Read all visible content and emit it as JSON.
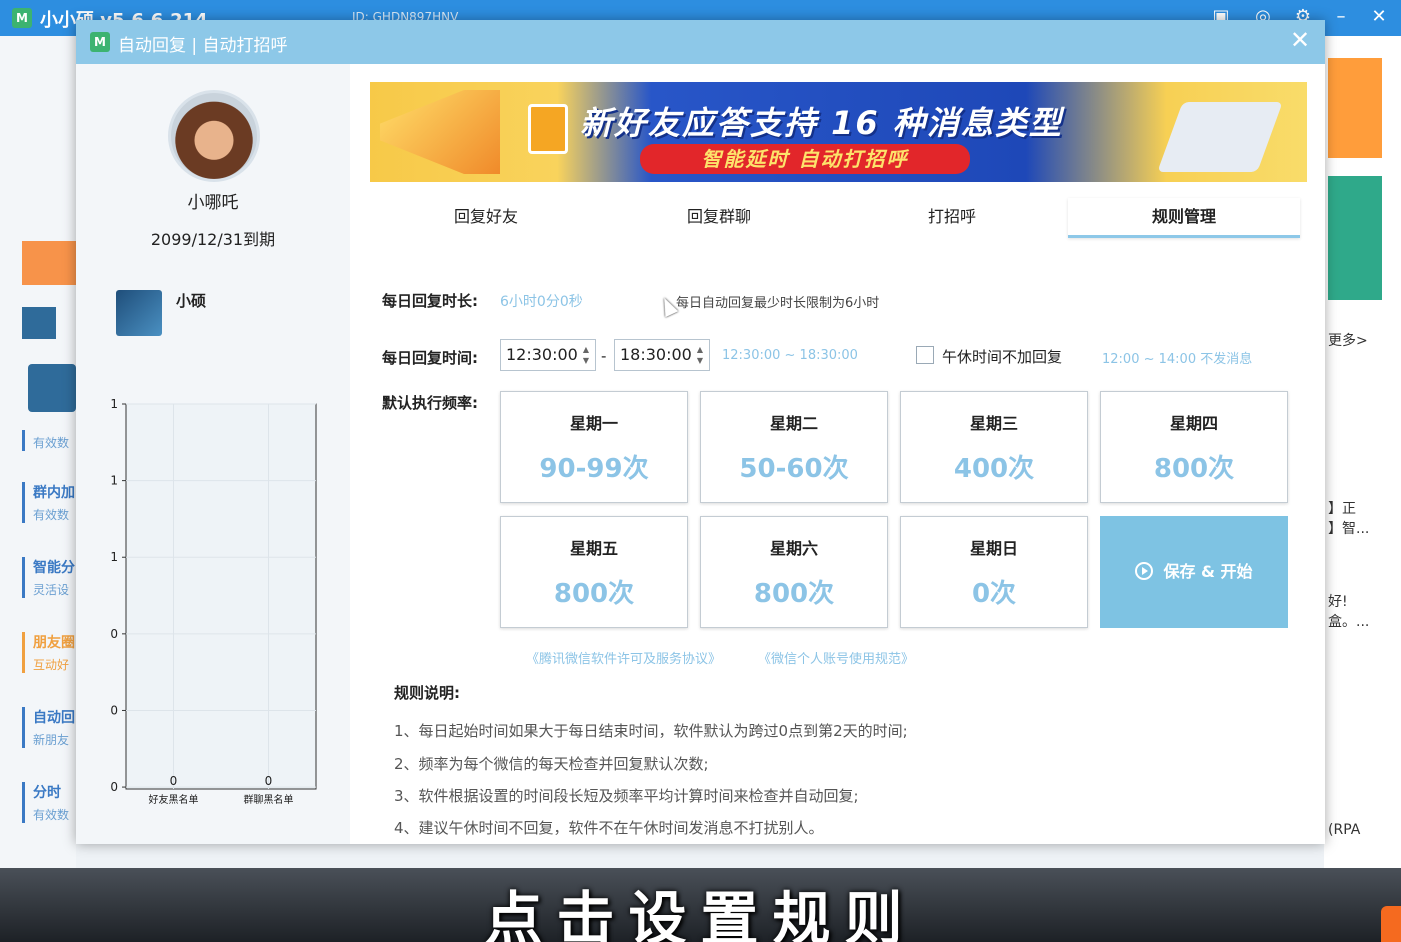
{
  "background_app": {
    "title": "小小硕 v5.6.6.214",
    "id_text": "ID: GHDN897HNV",
    "side_items": [
      {
        "title": "",
        "sub": "有效数"
      },
      {
        "title": "群内加",
        "sub": "有效数"
      },
      {
        "title": "智能分",
        "sub": "灵活设"
      },
      {
        "title": "朋友圈",
        "sub": "互动好"
      },
      {
        "title": "自动回",
        "sub": "新朋友"
      },
      {
        "title": "分时",
        "sub": "有效数"
      }
    ],
    "right_texts": [
      "更多>",
      "】正",
      "】智...",
      "好!",
      "盒。...",
      "(RPA"
    ]
  },
  "dialog": {
    "title": "自动回复 | 自动打招呼",
    "close_glyph": "✕",
    "user": {
      "name": "小哪吒",
      "expire": "2099/12/31到期",
      "account_name": "小硕"
    },
    "banner": {
      "headline": "新好友应答支持 16 种消息类型",
      "ribbon": "智能延时  自动打招呼"
    },
    "tabs": [
      {
        "label": "回复好友"
      },
      {
        "label": "回复群聊"
      },
      {
        "label": "打招呼"
      },
      {
        "label": "规则管理",
        "active": true
      }
    ],
    "daily_duration": {
      "label": "每日回复时长:",
      "value": "6小时0分0秒",
      "note": "每日自动回复最少时长限制为6小时"
    },
    "daily_time": {
      "label": "每日回复时间:",
      "start": "12:30:00",
      "end": "18:30:00",
      "separator": "-",
      "range_hint": "12:30:00 ~ 18:30:00",
      "lunch_checkbox_label": "午休时间不加回复",
      "lunch_checked": false,
      "lunch_hint": "12:00 ~ 14:00 不发消息"
    },
    "frequency": {
      "label": "默认执行频率:",
      "days": [
        {
          "name": "星期一",
          "value": "90-99次"
        },
        {
          "name": "星期二",
          "value": "50-60次"
        },
        {
          "name": "星期三",
          "value": "400次"
        },
        {
          "name": "星期四",
          "value": "800次"
        },
        {
          "name": "星期五",
          "value": "800次"
        },
        {
          "name": "星期六",
          "value": "800次"
        },
        {
          "name": "星期日",
          "value": "0次"
        }
      ],
      "save_label": "保存 & 开始"
    },
    "links": [
      "《腾讯微信软件许可及服务协议》",
      "《微信个人账号使用规范》"
    ],
    "rules": {
      "title": "规则说明:",
      "items": [
        "1、每日起始时间如果大于每日结束时间，软件默认为跨过0点到第2天的时间;",
        "2、频率为每个微信的每天检查并回复默认次数;",
        "3、软件根据设置的时间段长短及频率平均计算时间来检查并自动回复;",
        "4、建议午休时间不回复，软件不在午休时间发消息不打扰别人。"
      ]
    }
  },
  "subtitle": "点击设置规则",
  "chart_data": {
    "type": "bar",
    "categories": [
      "好友黑名单",
      "群聊黑名单"
    ],
    "values": [
      0,
      0
    ],
    "yticks": [
      "1",
      "1",
      "1",
      "0",
      "0",
      "0"
    ],
    "data_labels": [
      "0",
      "0"
    ],
    "ylim": [
      0,
      1
    ],
    "grid": true
  },
  "colors": {
    "accent": "#8dc8e8",
    "value_blue": "#8cc4e6",
    "save_button": "#7ec3e3",
    "title_bar": "#2d8ee0"
  }
}
